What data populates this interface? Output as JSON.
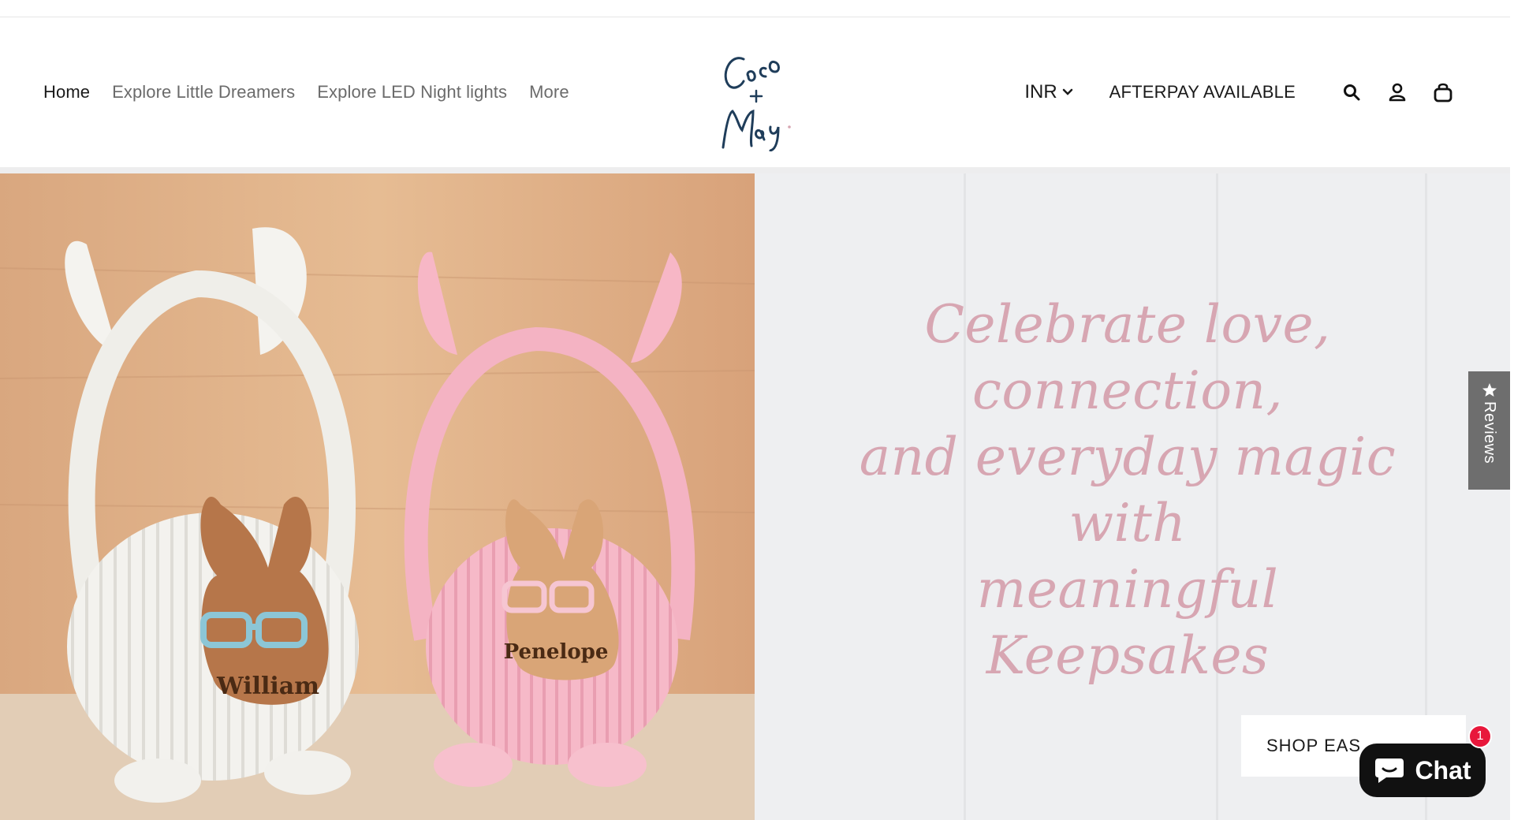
{
  "nav": {
    "items": [
      {
        "label": "Home",
        "active": true
      },
      {
        "label": "Explore Little Dreamers",
        "active": false
      },
      {
        "label": "Explore LED Night lights",
        "active": false
      },
      {
        "label": "More",
        "active": false
      }
    ]
  },
  "logo": {
    "alt_text": "Coco + May",
    "icon": "coco-may-logo"
  },
  "header": {
    "currency": "INR",
    "afterpay": "AFTERPAY AVAILABLE",
    "icons": [
      "search-icon",
      "account-icon",
      "cart-icon"
    ]
  },
  "hero": {
    "tagline_lines": [
      "Celebrate love, connection,",
      "and everyday magic with",
      "meaningful Keepsakes"
    ],
    "cta_label": "SHOP EAS",
    "image_names": [
      "William",
      "Penelope"
    ]
  },
  "reviews_tab": {
    "label": "Reviews",
    "icon": "star-icon"
  },
  "chat": {
    "label": "Chat",
    "badge": "1",
    "icon": "chat-bubble-icon"
  },
  "colors": {
    "tagline": "#d7a6b2",
    "chat_bg": "#111111",
    "badge": "#e8173b",
    "logo": "#1f3d5a"
  }
}
